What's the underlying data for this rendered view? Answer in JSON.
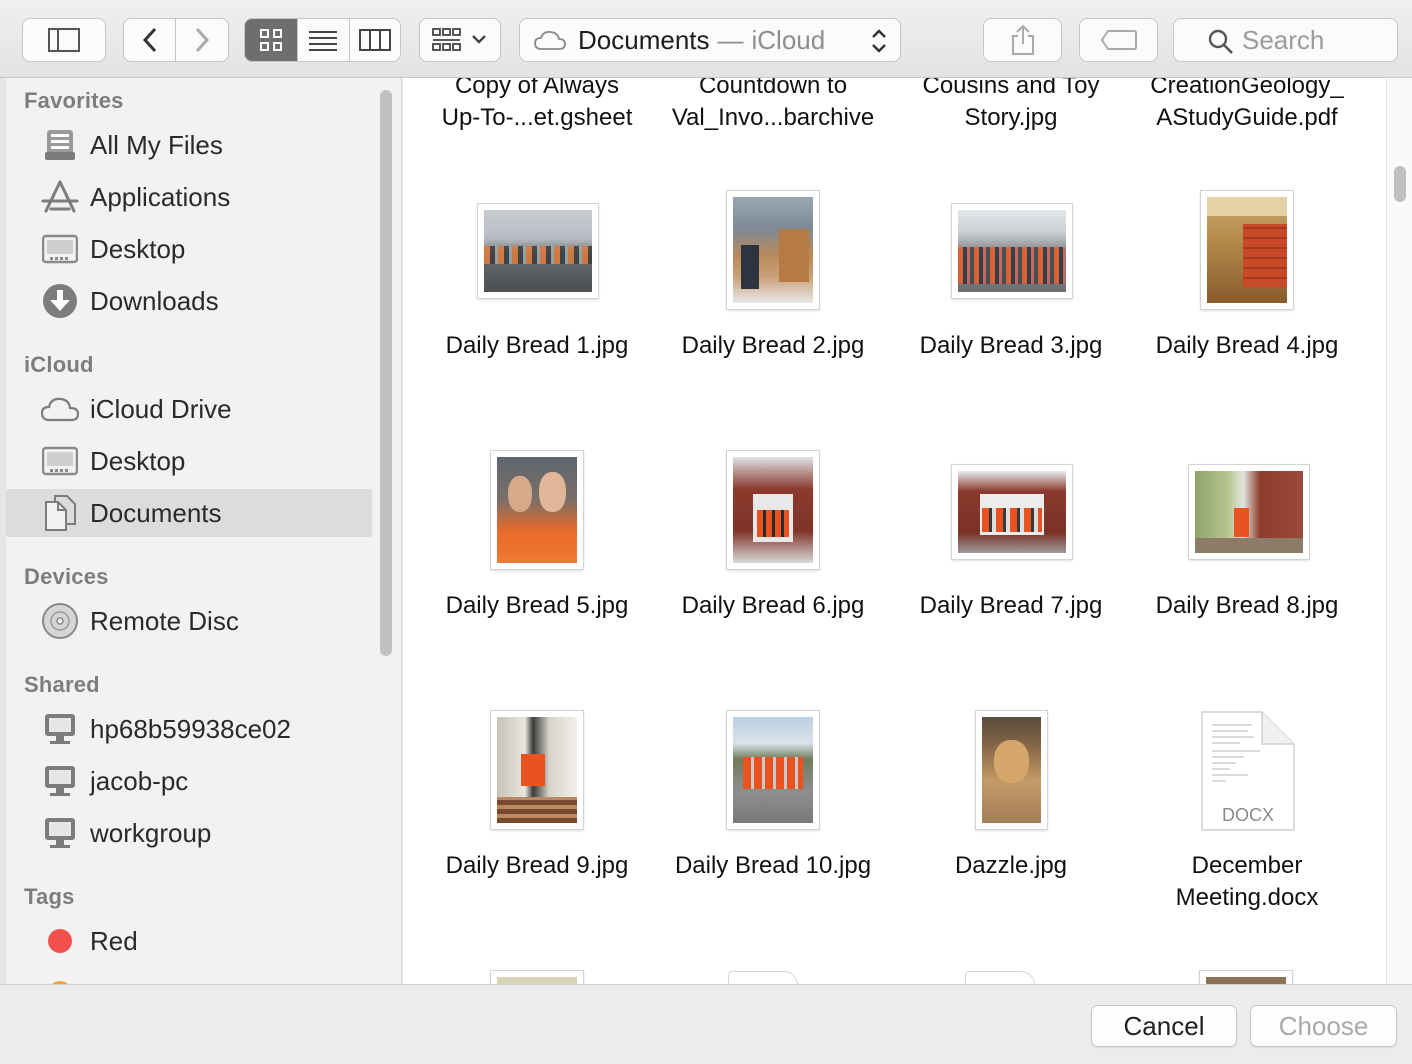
{
  "toolbar": {
    "path_folder": "Documents",
    "path_separator": "—",
    "path_location": "iCloud",
    "search_placeholder": "Search",
    "view_modes": [
      "icon-view",
      "list-view",
      "column-view"
    ],
    "active_view": "icon-view"
  },
  "sidebar": {
    "sections": {
      "favorites": "Favorites",
      "icloud": "iCloud",
      "devices": "Devices",
      "shared": "Shared",
      "tags": "Tags"
    },
    "favorites": [
      "All My Files",
      "Applications",
      "Desktop",
      "Downloads"
    ],
    "icloud": [
      "iCloud Drive",
      "Desktop",
      "Documents"
    ],
    "devices": [
      "Remote Disc"
    ],
    "shared": [
      "hp68b59938ce02",
      "jacob-pc",
      "workgroup"
    ],
    "tags": [
      "Red"
    ],
    "selected": "Documents",
    "colors": {
      "red_tag": "#f2504b",
      "orange_tag": "#f5a33a"
    }
  },
  "files": {
    "row0": [
      {
        "line1": "Copy of Always",
        "line2": "Up-To-...et.gsheet"
      },
      {
        "line1": "Countdown to",
        "line2": "Val_Invo...barchive"
      },
      {
        "line1": "Cousins and Toy",
        "line2": "Story.jpg"
      },
      {
        "line1": "CreationGeology_",
        "line2": "AStudyGuide.pdf"
      }
    ],
    "row1": [
      "Daily Bread 1.jpg",
      "Daily Bread 2.jpg",
      "Daily Bread 3.jpg",
      "Daily Bread 4.jpg"
    ],
    "row2": [
      "Daily Bread 5.jpg",
      "Daily Bread 6.jpg",
      "Daily Bread 7.jpg",
      "Daily Bread 8.jpg"
    ],
    "row3": [
      {
        "line1": "Daily Bread 9.jpg"
      },
      {
        "line1": "Daily Bread 10.jpg"
      },
      {
        "line1": "Dazzle.jpg"
      },
      {
        "line1": "December",
        "line2": "Meeting.docx"
      }
    ],
    "docx_badge": "DOCX"
  },
  "footer": {
    "cancel_label": "Cancel",
    "choose_label": "Choose"
  }
}
